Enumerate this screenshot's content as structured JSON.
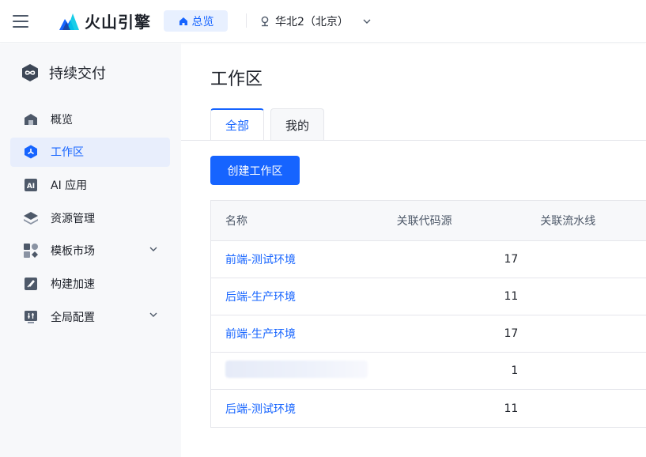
{
  "header": {
    "brand": "火山引擎",
    "home_label": "总览",
    "region": "华北2（北京）"
  },
  "sidebar": {
    "product_title": "持续交付",
    "items": [
      {
        "label": "概览",
        "icon": "home-icon"
      },
      {
        "label": "工作区",
        "icon": "workspace-icon",
        "active": true
      },
      {
        "label": "AI 应用",
        "icon": "ai-icon"
      },
      {
        "label": "资源管理",
        "icon": "layers-icon"
      },
      {
        "label": "模板市场",
        "icon": "grid-icon",
        "expandable": true
      },
      {
        "label": "构建加速",
        "icon": "rocket-icon"
      },
      {
        "label": "全局配置",
        "icon": "settings-icon",
        "expandable": true
      }
    ]
  },
  "main": {
    "title": "工作区",
    "tabs": [
      {
        "label": "全部",
        "active": true
      },
      {
        "label": "我的"
      }
    ],
    "create_button": "创建工作区",
    "table": {
      "columns": [
        "名称",
        "关联代码源",
        "关联流水线"
      ],
      "rows": [
        {
          "name": "前端-测试环境",
          "code_sources": "17"
        },
        {
          "name": "后端-生产环境",
          "code_sources": "11"
        },
        {
          "name": "前端-生产环境",
          "code_sources": "17"
        },
        {
          "name": "",
          "code_sources": "1",
          "redacted": true
        },
        {
          "name": "后端-测试环境",
          "code_sources": "11"
        }
      ]
    }
  },
  "colors": {
    "accent": "#1664ff",
    "sidebar_bg": "#f7f8fa",
    "active_bg": "#e8eefc"
  }
}
